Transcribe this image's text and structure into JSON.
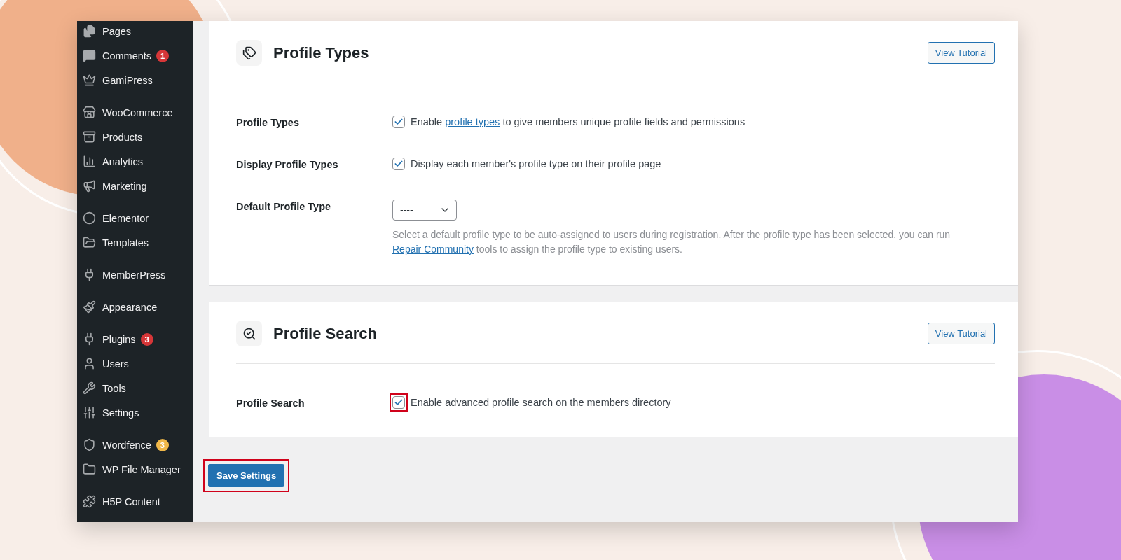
{
  "sidebar": {
    "groups": [
      {
        "items": [
          {
            "label": "Pages"
          },
          {
            "label": "Comments",
            "badge": {
              "text": "1",
              "color": "#d63638"
            }
          },
          {
            "label": "GamiPress"
          }
        ]
      },
      {
        "items": [
          {
            "label": "WooCommerce"
          },
          {
            "label": "Products"
          },
          {
            "label": "Analytics"
          },
          {
            "label": "Marketing"
          }
        ]
      },
      {
        "items": [
          {
            "label": "Elementor"
          },
          {
            "label": "Templates"
          }
        ]
      },
      {
        "items": [
          {
            "label": "MemberPress"
          }
        ]
      },
      {
        "items": [
          {
            "label": "Appearance"
          }
        ]
      },
      {
        "items": [
          {
            "label": "Plugins",
            "badge": {
              "text": "3",
              "color": "#d63638"
            }
          },
          {
            "label": "Users"
          },
          {
            "label": "Tools"
          },
          {
            "label": "Settings"
          }
        ]
      },
      {
        "items": [
          {
            "label": "Wordfence",
            "badge": {
              "text": "3",
              "color": "#f0b849"
            }
          },
          {
            "label": "WP File Manager"
          }
        ]
      },
      {
        "items": [
          {
            "label": "H5P Content"
          }
        ]
      }
    ]
  },
  "panels": [
    {
      "title": "Profile Types",
      "button": "View Tutorial",
      "rows": [
        {
          "kind": "checkbox",
          "label": "Profile Types",
          "checked": true,
          "text": {
            "before": "Enable",
            "link": "profile types",
            "after": "to give members unique profile fields and permissions"
          }
        },
        {
          "kind": "checkbox",
          "label": "Display Profile Types",
          "checked": true,
          "text": {
            "before": "Display each member's profile type on their profile page"
          }
        },
        {
          "kind": "select",
          "label": "Default Profile Type",
          "value": "----",
          "description": {
            "before": "Select a default profile type to be auto-assigned to users during registration. After the profile type has been selected, you can run",
            "link": "Repair Community",
            "after": "tools to assign the profile type to existing users."
          }
        }
      ]
    },
    {
      "title": "Profile Search",
      "button": "View Tutorial",
      "rows": [
        {
          "kind": "checkbox",
          "label": "Profile Search",
          "checked": true,
          "highlighted": true,
          "text": {
            "before": "Enable advanced profile search on the members directory"
          }
        }
      ]
    }
  ],
  "save_button": {
    "label": "Save Settings",
    "highlighted": true
  }
}
